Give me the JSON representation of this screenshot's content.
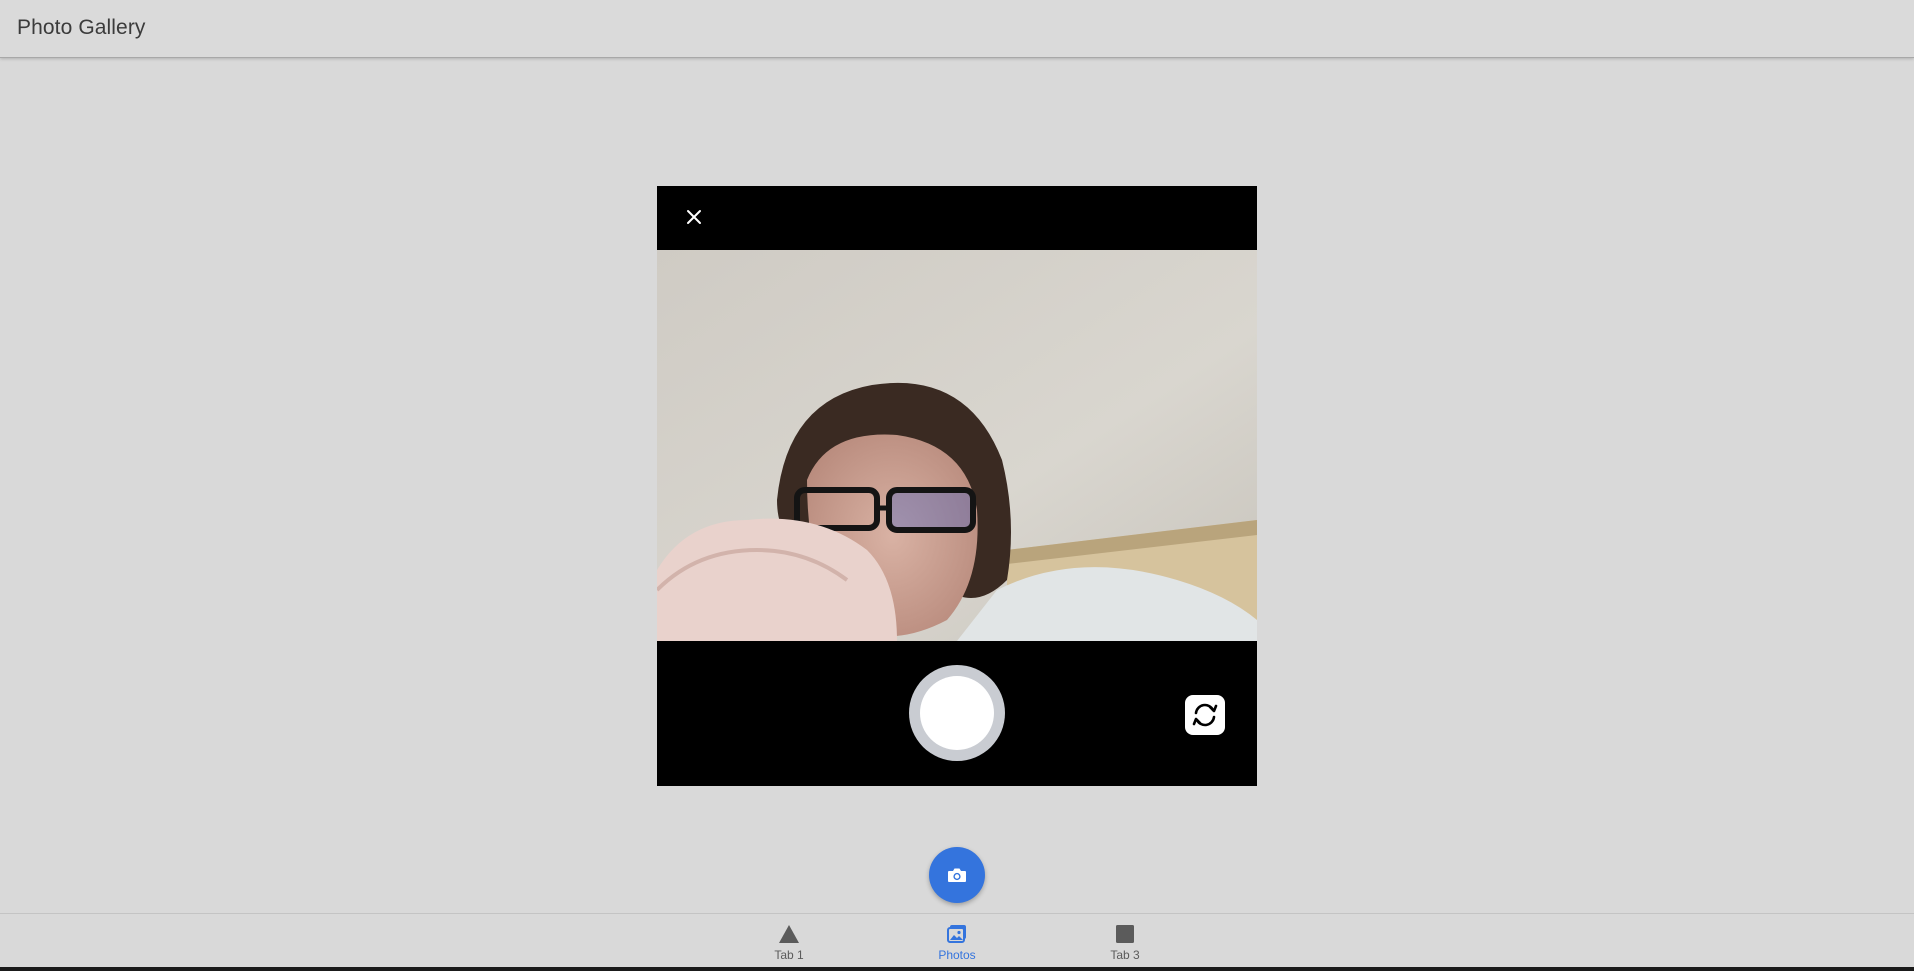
{
  "header": {
    "title": "Photo Gallery"
  },
  "camera": {
    "close_icon": "close-icon",
    "flip_icon": "camera-reverse-icon",
    "shutter_icon": "shutter-button"
  },
  "fab": {
    "icon": "camera-icon",
    "color": "#3474dd"
  },
  "tabs": [
    {
      "label": "Tab 1",
      "icon": "triangle-icon",
      "active": false
    },
    {
      "label": "Photos",
      "icon": "images-icon",
      "active": true
    },
    {
      "label": "Tab 3",
      "icon": "square-icon",
      "active": false
    }
  ],
  "colors": {
    "accent": "#3474dd",
    "background": "#d9d9d9"
  }
}
